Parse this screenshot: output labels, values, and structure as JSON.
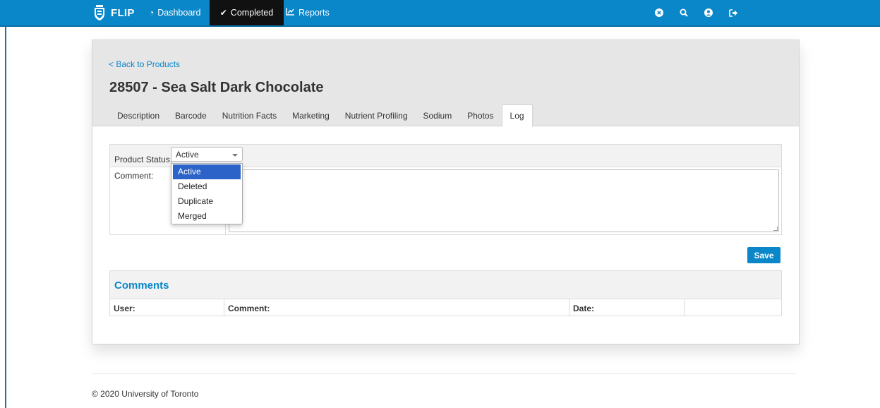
{
  "nav": {
    "brand": "FLIP",
    "dashboard_label": "Dashboard",
    "completed_label": "Completed",
    "reports_label": "Reports",
    "icons": [
      "times-circle-icon",
      "search-icon",
      "user-circle-icon",
      "sign-out-icon"
    ]
  },
  "page": {
    "back_link": "< Back to Products",
    "title": "28507 - Sea Salt Dark Chocolate"
  },
  "tabs": [
    {
      "label": "Description"
    },
    {
      "label": "Barcode"
    },
    {
      "label": "Nutrition Facts"
    },
    {
      "label": "Marketing"
    },
    {
      "label": "Nutrient Profiling"
    },
    {
      "label": "Sodium"
    },
    {
      "label": "Photos"
    },
    {
      "label": "Log",
      "active": true
    }
  ],
  "form": {
    "status_label": "Product Status:",
    "status_value": "Active",
    "status_options": [
      "Active",
      "Deleted",
      "Duplicate",
      "Merged"
    ],
    "comment_label": "Comment:",
    "comment_value": "",
    "save_label": "Save"
  },
  "comments": {
    "title": "Comments",
    "columns": [
      "User:",
      "Comment:",
      "Date:",
      ""
    ]
  },
  "footer": "© 2020 University of Toronto",
  "colors": {
    "nav_bg": "#0a87c9",
    "active_nav_bg": "#111111",
    "link": "#0a87c9",
    "selected_option": "#2b63c9"
  }
}
